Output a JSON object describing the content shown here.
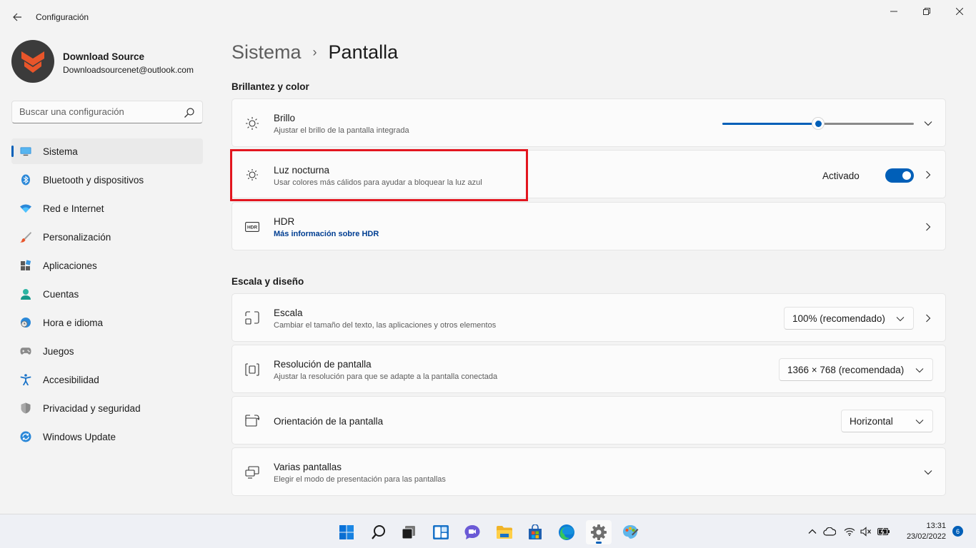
{
  "window": {
    "title": "Configuración"
  },
  "profile": {
    "name": "Download Source",
    "email": "Downloadsourcenet@outlook.com"
  },
  "search": {
    "placeholder": "Buscar una configuración"
  },
  "nav": {
    "items": [
      {
        "label": "Sistema",
        "icon": "system-icon",
        "active": true
      },
      {
        "label": "Bluetooth y dispositivos",
        "icon": "bluetooth-icon"
      },
      {
        "label": "Red e Internet",
        "icon": "wifi-icon"
      },
      {
        "label": "Personalización",
        "icon": "brush-icon"
      },
      {
        "label": "Aplicaciones",
        "icon": "apps-icon"
      },
      {
        "label": "Cuentas",
        "icon": "account-icon"
      },
      {
        "label": "Hora e idioma",
        "icon": "globe-clock-icon"
      },
      {
        "label": "Juegos",
        "icon": "gamepad-icon"
      },
      {
        "label": "Accesibilidad",
        "icon": "accessibility-icon"
      },
      {
        "label": "Privacidad y seguridad",
        "icon": "shield-icon"
      },
      {
        "label": "Windows Update",
        "icon": "update-icon"
      }
    ]
  },
  "breadcrumb": {
    "parent": "Sistema",
    "separator": "›",
    "current": "Pantalla"
  },
  "sections": {
    "brightness_color": "Brillantez y color",
    "scale_layout": "Escala y diseño"
  },
  "cards": {
    "brightness": {
      "title": "Brillo",
      "subtitle": "Ajustar el brillo de la pantalla integrada",
      "level_percent": 50
    },
    "night_light": {
      "title": "Luz nocturna",
      "subtitle": "Usar colores más cálidos para ayudar a bloquear la luz azul",
      "status": "Activado",
      "on": true
    },
    "hdr": {
      "title": "HDR",
      "link": "Más información sobre HDR",
      "icon_text": "HDR"
    },
    "scale": {
      "title": "Escala",
      "subtitle": "Cambiar el tamaño del texto, las aplicaciones y otros elementos",
      "value": "100% (recomendado)"
    },
    "resolution": {
      "title": "Resolución de pantalla",
      "subtitle": "Ajustar la resolución para que se adapte a la pantalla conectada",
      "value": "1366 × 768 (recomendada)"
    },
    "orientation": {
      "title": "Orientación de la pantalla",
      "value": "Horizontal"
    },
    "multi_display": {
      "title": "Varias pantallas",
      "subtitle": "Elegir el modo de presentación para las pantallas"
    }
  },
  "taskbar": {
    "apps": [
      "start-icon",
      "search-icon",
      "task-view-icon",
      "widgets-icon",
      "chat-icon",
      "file-explorer-icon",
      "store-icon",
      "edge-icon",
      "settings-icon",
      "paint-icon"
    ],
    "active_app": "settings-icon",
    "time": "13:31",
    "date": "23/02/2022",
    "notification_count": "6"
  },
  "colors": {
    "accent": "#005fb8",
    "highlight_box": "#e3161f",
    "avatar_logo": "#e8552a"
  }
}
